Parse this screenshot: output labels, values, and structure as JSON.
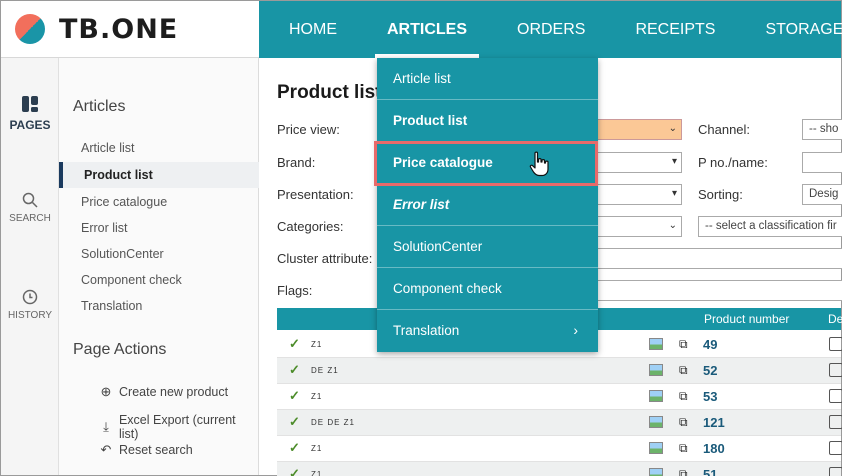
{
  "brand": {
    "name": "TB.ONE"
  },
  "topnav": {
    "items": [
      "HOME",
      "ARTICLES",
      "ORDERS",
      "RECEIPTS",
      "STORAGE"
    ],
    "active": "ARTICLES"
  },
  "rail": {
    "pages": "PAGES",
    "search": "SEARCH",
    "history": "HISTORY"
  },
  "sidebar": {
    "title": "Articles",
    "links": [
      "Article list",
      "Product list",
      "Price catalogue",
      "Error list",
      "SolutionCenter",
      "Component check",
      "Translation"
    ],
    "active": "Product list",
    "actions_title": "Page Actions",
    "actions": [
      "Create new product",
      "Excel Export (current list)",
      "Reset search"
    ]
  },
  "main": {
    "title": "Product list",
    "filters": {
      "price_view": "Price view:",
      "brand": "Brand:",
      "presentation": "Presentation:",
      "categories": "Categories:",
      "cluster": "Cluster attribute:",
      "flags": "Flags:",
      "channel": "Channel:",
      "pno": "P no./name:",
      "sorting": "Sorting:",
      "channel_value": "-- sho",
      "sorting_value": "Desig",
      "classification": "-- select a classification fir"
    },
    "table": {
      "col_product_number": "Product number",
      "col_de": "De",
      "rows": [
        {
          "flags": "Z1",
          "number": "49"
        },
        {
          "flags": "DE Z1",
          "number": "52"
        },
        {
          "flags": "Z1",
          "number": "53"
        },
        {
          "flags": "DE DE Z1",
          "number": "121"
        },
        {
          "flags": "Z1",
          "number": "180"
        },
        {
          "flags": "Z1",
          "number": "51"
        }
      ]
    }
  },
  "dropdown": {
    "items": [
      "Article list",
      "Product list",
      "Price catalogue",
      "Error list",
      "SolutionCenter",
      "Component check",
      "Translation"
    ],
    "highlighted": "Price catalogue"
  },
  "colors": {
    "teal": "#1895a5",
    "accent": "#f26f5c",
    "highlight": "#e86a6a",
    "orange_field": "#fbc896"
  }
}
